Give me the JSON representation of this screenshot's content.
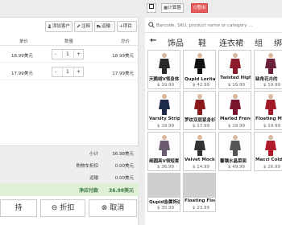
{
  "toolbar": {
    "add_customer": "添加客户",
    "note": "注释",
    "shipping": "运输",
    "item": "项目"
  },
  "table": {
    "col_price": "单价",
    "col_qty": "数量",
    "col_total": "总价"
  },
  "cart": [
    {
      "price": "18.99美元",
      "qty": "1",
      "total": "18.99美元"
    },
    {
      "price": "17.99美元",
      "qty": "1",
      "total": "17.99美元"
    }
  ],
  "stepper": {
    "minus": "-",
    "plus": "+"
  },
  "summary": {
    "subtotal_label": "小计",
    "subtotal_value": "36.98美元",
    "discount_label": "购物车折扣",
    "discount_value": "0.00美元",
    "shipping_label": "运输",
    "shipping_value": "0.00美元",
    "net_label": "净应付款",
    "net_value": "36.98美元"
  },
  "actions": {
    "hold": "持",
    "discount": "折扣",
    "cancel": "取消"
  },
  "right_toolbar": {
    "calculator": "计算器",
    "logout": "登出"
  },
  "search": {
    "placeholder": "Barcode, SKU, product name or category ..."
  },
  "categories": [
    "饰品",
    "鞋",
    "连衣裙",
    "组",
    "绑"
  ],
  "products": [
    {
      "name": "天鹅绒V领身体",
      "price": "$ 19.99",
      "color": "#2a2a2a"
    },
    {
      "name": "Qupid Lorita高跟",
      "price": "$ 42.99",
      "color": "#111111"
    },
    {
      "name": "Twisted High-Low",
      "price": "$ 19.99",
      "color": "#8a1c2b"
    },
    {
      "name": "缺角花卉的",
      "price": "$ 19.99",
      "color": "#6b1f3a"
    },
    {
      "name": "Varsity Stripe J",
      "price": "$ 19.99",
      "color": "#1e2a4a"
    },
    {
      "name": "罗纹双层紧身衫",
      "price": "$ 17.99",
      "color": "#8b1b1b"
    },
    {
      "name": "Marled French T",
      "price": "$ 19.99",
      "color": "#7a1530"
    },
    {
      "name": "Floating Mo",
      "price": "$ 19.99",
      "color": "#a11a2a"
    },
    {
      "name": "细圆高V领短套",
      "price": "$ 36.99",
      "color": "#6b5a70"
    },
    {
      "name": "Velvet Mock Ne",
      "price": "$ 14.99",
      "color": "#333333"
    },
    {
      "name": "馨镶水晶菜面",
      "price": "$ 49.99",
      "color": "#555555"
    },
    {
      "name": "Macci Cold S",
      "price": "$ 26.99",
      "color": "#b01a2a"
    },
    {
      "name": "Qupid金属饰边",
      "price": "$ 35.99",
      "color": ""
    },
    {
      "name": "Floating Floock",
      "price": "$ 23.99",
      "color": ""
    }
  ]
}
